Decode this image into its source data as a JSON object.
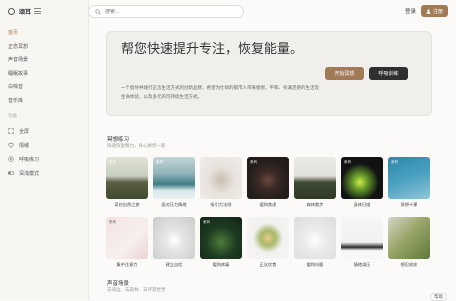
{
  "app": {
    "name": "颂耳"
  },
  "search": {
    "placeholder": "搜索..."
  },
  "header": {
    "login": "登录",
    "register": "注册"
  },
  "sidebar": {
    "items": [
      {
        "label": "首页",
        "active": true
      },
      {
        "label": "正念冥想",
        "active": false
      },
      {
        "label": "声音场景",
        "active": false
      },
      {
        "label": "睡眠故事",
        "active": false
      },
      {
        "label": "白噪音",
        "active": false
      },
      {
        "label": "音乐库",
        "active": false
      }
    ],
    "section_label": "功能",
    "sub_items": [
      {
        "label": "全屏",
        "icon": "fullscreen-icon"
      },
      {
        "label": "情绪",
        "icon": "mood-icon"
      },
      {
        "label": "呼吸练习",
        "icon": "breathing-icon"
      },
      {
        "label": "深浅模式",
        "icon": "theme-toggle-icon"
      }
    ]
  },
  "hero": {
    "title": "帮您快速提升专注，恢复能量。",
    "description": "一个倡导并践行正念生活方式的创新品牌，希望为忙碌的都市人带来愉悦、平和、有满足感的生活及生命体验，以及多元的可持续生活方式。",
    "start_label": "开始冥想",
    "breath_label": "呼吸训练"
  },
  "meditation": {
    "title": "冥想练习",
    "subtitle": "快速恢复精力，身心焕然一新",
    "row1": [
      {
        "caption": "奇妙自然之旅",
        "badge": "系列"
      },
      {
        "caption": "面对压力情绪",
        "badge": "系列"
      },
      {
        "caption": "吸引力法则",
        "badge": ""
      },
      {
        "caption": "缓和焦虑",
        "badge": "系列"
      },
      {
        "caption": "森林散步",
        "badge": ""
      },
      {
        "caption": "身体扫描",
        "badge": "系列"
      },
      {
        "caption": "冥想十课",
        "badge": "系列"
      }
    ],
    "row2": [
      {
        "caption": "集中注意力",
        "badge": "系列"
      },
      {
        "caption": "建立自信",
        "badge": ""
      },
      {
        "caption": "缓和疼痛",
        "badge": "系列"
      },
      {
        "caption": "正念饮食",
        "badge": ""
      },
      {
        "caption": "缓和抗躯",
        "badge": ""
      },
      {
        "caption": "情绪减压",
        "badge": ""
      },
      {
        "caption": "想忍放弃",
        "badge": ""
      }
    ]
  },
  "sounds": {
    "title": "声音场景",
    "subtitle": "去海边、去森林、去环游世界"
  },
  "help": {
    "label": "帮助"
  },
  "colors": {
    "accent": "#a27a55",
    "dark": "#2f2f2f",
    "sidebar_bg": "#f7f6f3"
  }
}
